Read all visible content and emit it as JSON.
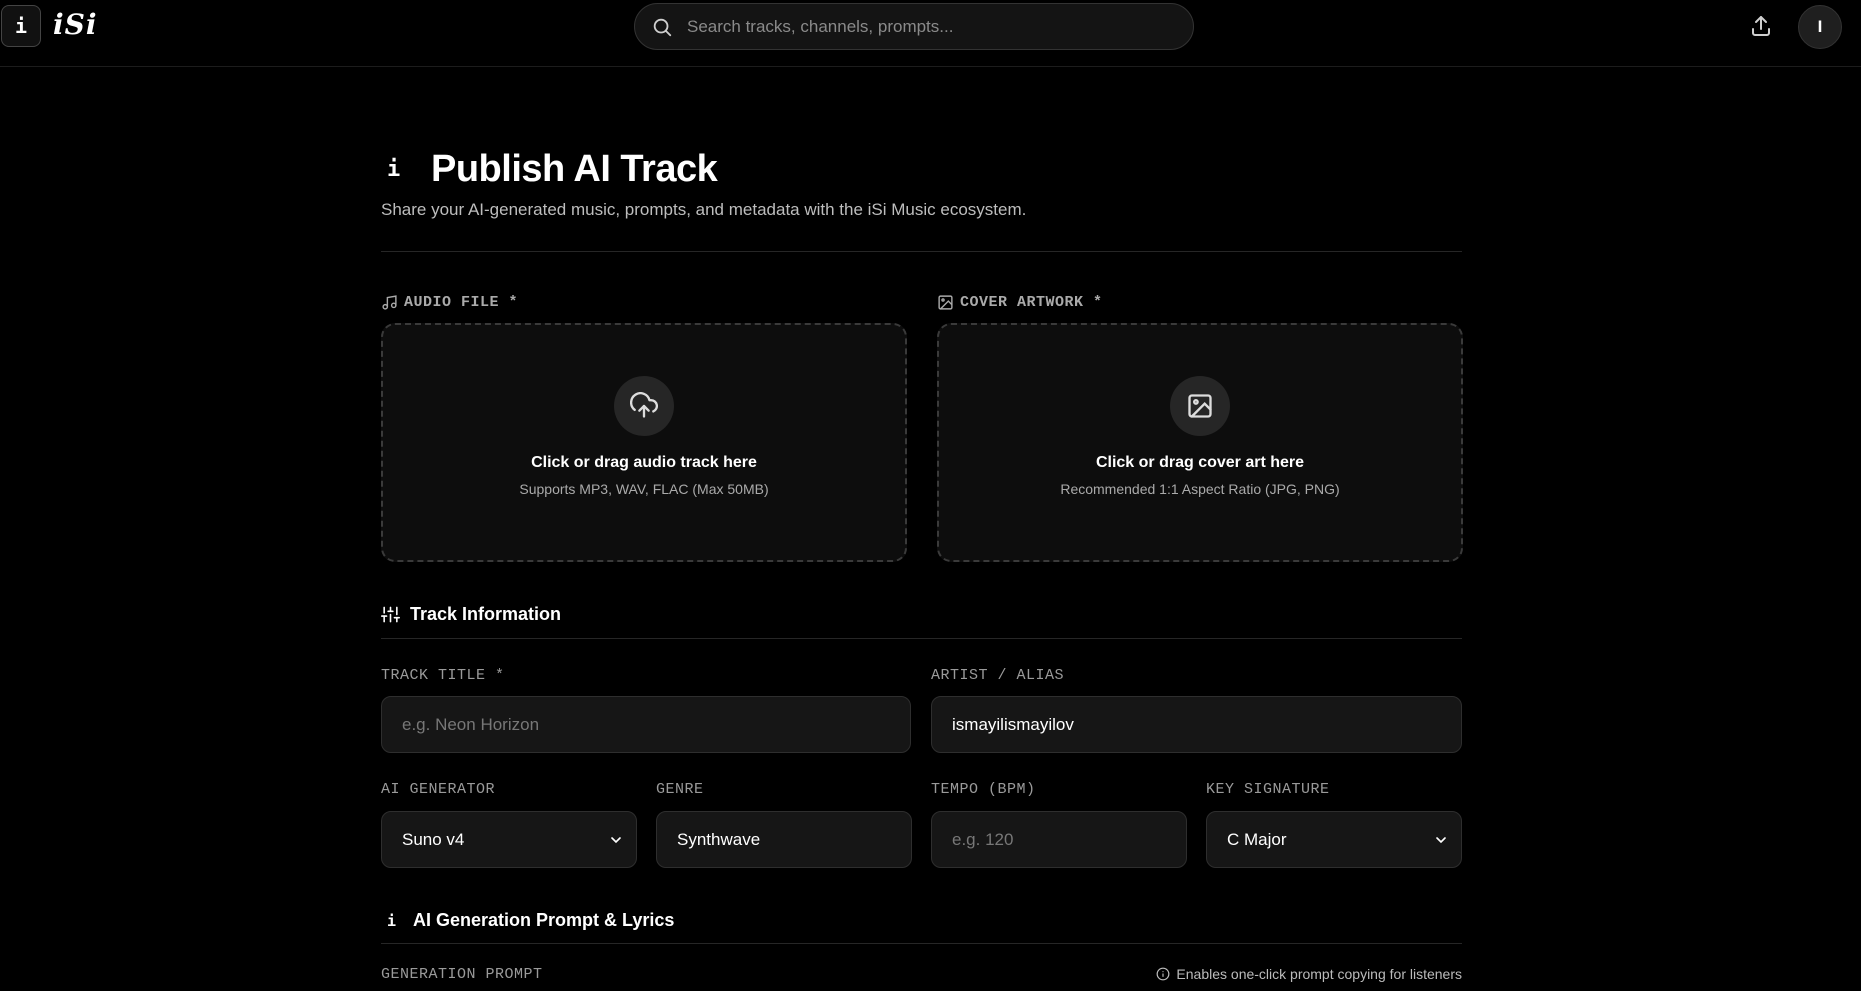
{
  "header": {
    "logo_glyph": "i",
    "brand": "iSi",
    "search_placeholder": "Search tracks, channels, prompts...",
    "avatar_initial": "I"
  },
  "page": {
    "title_icon": "i",
    "title": "Publish AI Track",
    "subtitle": "Share your AI-generated music, prompts, and metadata with the iSi Music ecosystem."
  },
  "uploads": {
    "audio": {
      "label": "AUDIO FILE *",
      "primary": "Click or drag audio track here",
      "secondary": "Supports MP3, WAV, FLAC (Max 50MB)"
    },
    "cover": {
      "label": "COVER ARTWORK *",
      "primary": "Click or drag cover art here",
      "secondary": "Recommended 1:1 Aspect Ratio (JPG, PNG)"
    }
  },
  "track_info": {
    "heading": "Track Information",
    "title_label": "TRACK TITLE *",
    "title_placeholder": "e.g. Neon Horizon",
    "title_value": "",
    "artist_label": "ARTIST / ALIAS",
    "artist_value": "ismayilismayilov",
    "generator_label": "AI GENERATOR",
    "generator_value": "Suno v4",
    "genre_label": "GENRE",
    "genre_value": "Synthwave",
    "tempo_label": "TEMPO (BPM)",
    "tempo_placeholder": "e.g. 120",
    "tempo_value": "",
    "key_label": "KEY SIGNATURE",
    "key_value": "C Major"
  },
  "prompt_section": {
    "heading_icon": "i",
    "heading": "AI Generation Prompt & Lyrics",
    "prompt_label": "GENERATION PROMPT",
    "hint": "Enables one-click prompt copying for listeners"
  }
}
